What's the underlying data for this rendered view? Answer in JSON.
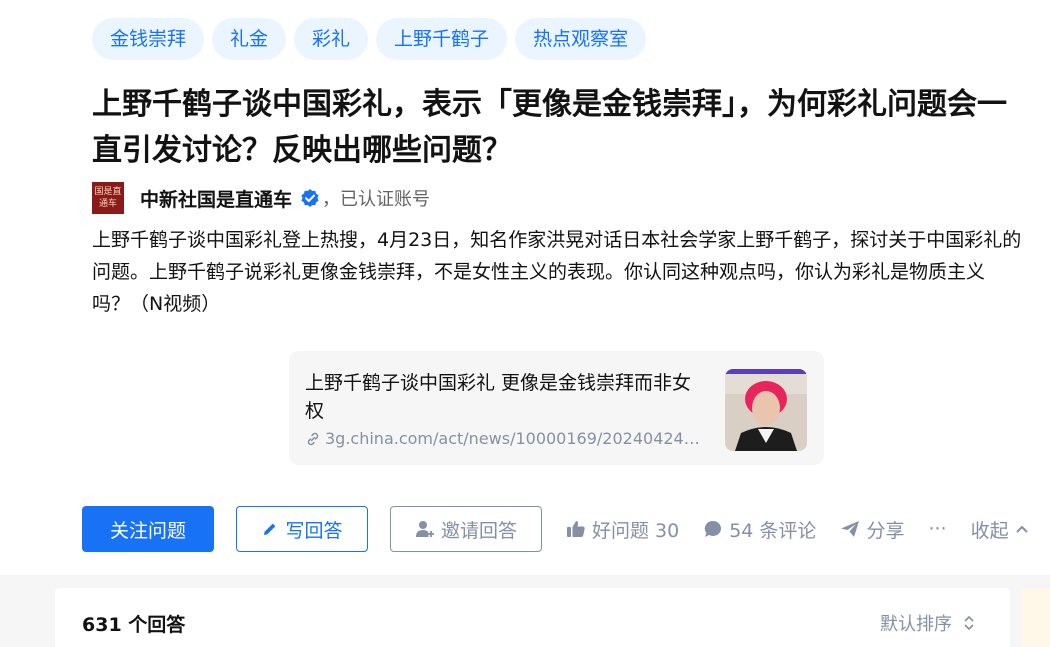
{
  "tags": [
    "金钱崇拜",
    "礼金",
    "彩礼",
    "上野千鹤子",
    "热点观察室"
  ],
  "question": {
    "title": "上野千鹤子谈中国彩礼，表示「更像是金钱崇拜」，为何彩礼问题会一直引发讨论？反映出哪些问题？",
    "author": "中新社国是直通车",
    "avatar_text": "国是直通车",
    "verified_label": "，已认证账号",
    "description": "上野千鹤子谈中国彩礼登上热搜，4月23日，知名作家洪晃对话日本社会学家上野千鹤子，探讨关于中国彩礼的问题。上野千鹤子说彩礼更像金钱崇拜，不是女性主义的表现。你认同这种观点吗，你认为彩礼是物质主义吗？（N视频）"
  },
  "link_card": {
    "title": "上野千鹤子谈中国彩礼 更像是金钱崇拜而非女权",
    "url": "3g.china.com/act/news/10000169/20240424…"
  },
  "actions": {
    "follow": "关注问题",
    "write": "写回答",
    "invite": "邀请回答",
    "good_question": "好问题 30",
    "comments": "54 条评论",
    "share": "分享",
    "more": "···",
    "collapse": "收起"
  },
  "answers": {
    "count": "631 个回答",
    "sort": "默认排序"
  },
  "colors": {
    "accent": "#1772f6",
    "gray": "#8590a6",
    "tag_bg": "#ebf5ff"
  }
}
